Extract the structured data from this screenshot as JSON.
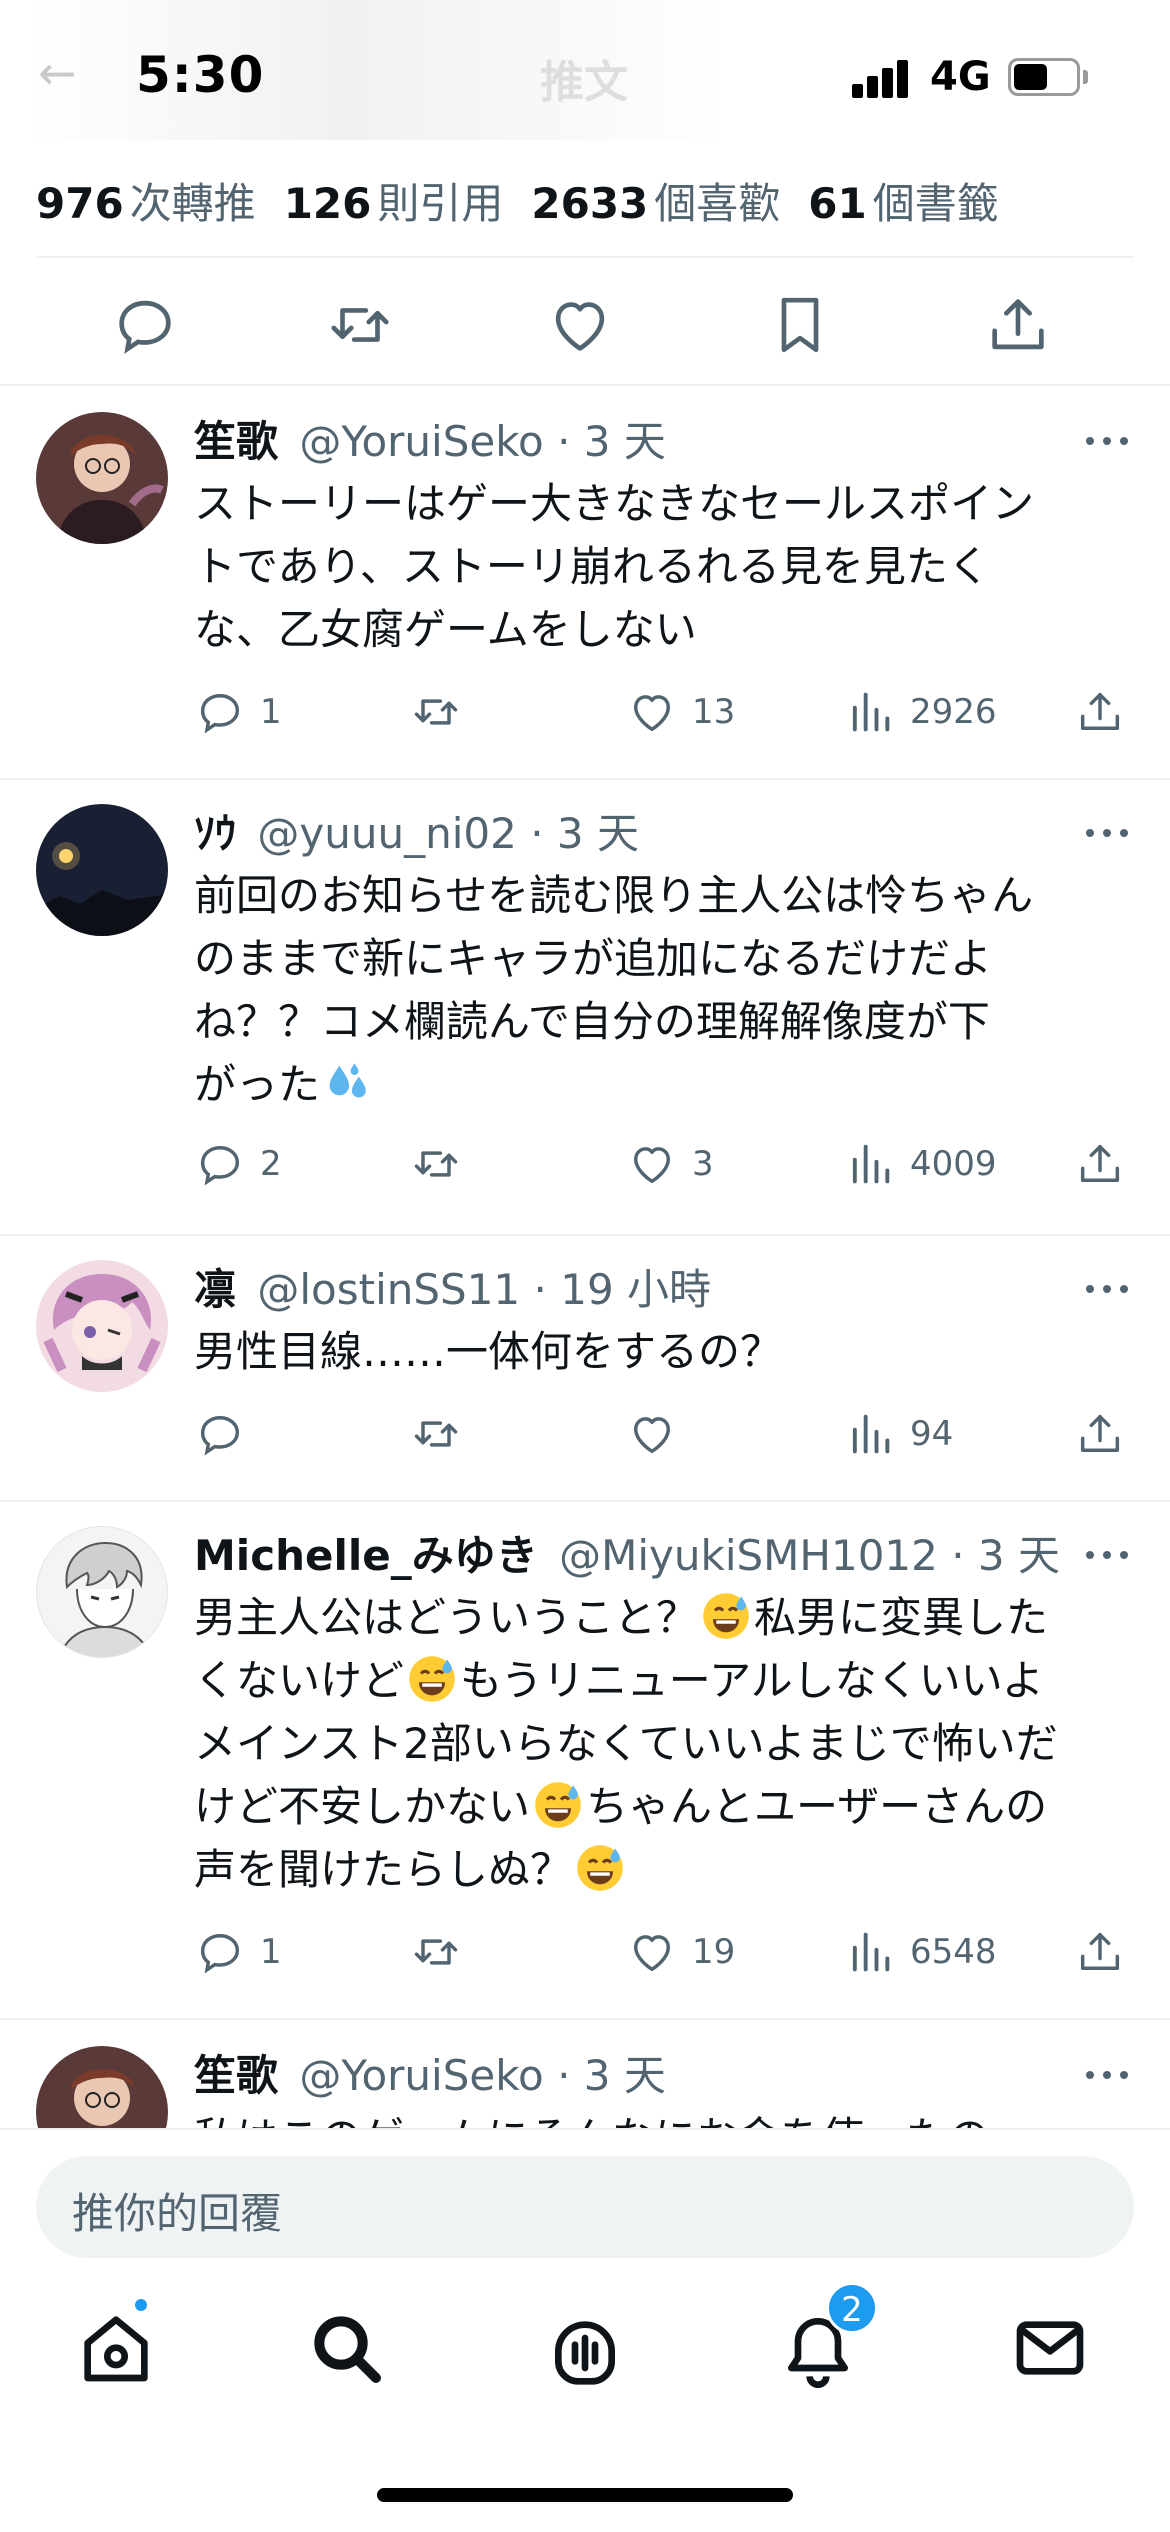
{
  "status_bar": {
    "time": "5:30",
    "network": "4G",
    "battery_level": 0.55
  },
  "header": {
    "title": "推文",
    "back_icon": "arrow-left-icon"
  },
  "stats": [
    {
      "value": "976",
      "label": "次轉推"
    },
    {
      "value": "126",
      "label": "則引用"
    },
    {
      "value": "2633",
      "label": "個喜歡"
    },
    {
      "value": "61",
      "label": "個書籤"
    }
  ],
  "tweet_actions": [
    "reply-icon",
    "retweet-icon",
    "like-icon",
    "bookmark-icon",
    "share-icon"
  ],
  "replies": [
    {
      "name": "笙歌",
      "handle": "@YoruiSeko",
      "time": "· 3 天",
      "lines": [
        "ストーリーはゲー大きなきなセールスポイン",
        "トであり、ストーリ崩れるれる見を見たく",
        "な、乙女腐ゲームをしない"
      ],
      "reply_count": "1",
      "like_count": "13",
      "view_count": "2926"
    },
    {
      "name": "ｿｳ",
      "handle": "@yuuu_ni02",
      "time": "· 3 天",
      "lines": [
        "前回のお知らせを読む限り主人公は怜ちゃん",
        "のままで新にキャラが追加になるだけだよ",
        "ね？？コメ欄読んで自分の理解解像度が下",
        "がった"
      ],
      "reply_count": "2",
      "like_count": "3",
      "view_count": "4009"
    },
    {
      "name": "凛",
      "handle": "@lostinSS11",
      "time": "· 19 小時",
      "lines": [
        "男性目線……一体何をするの？"
      ],
      "reply_count": "",
      "like_count": "",
      "view_count": "94"
    },
    {
      "name": "Michelle_みゆき",
      "handle": "@MiyukiSMH1012",
      "time": "· 3 天",
      "segments": [
        "男主人公はどういうこと？",
        "私男に変異した",
        "くないけど",
        "もうリニューアルしなくいいよ",
        "メインスト2部いらなくていいよまじで怖いだ",
        "けど不安しかない",
        "ちゃんとユーザーさんの",
        "声を聞けたらしぬ？"
      ],
      "reply_count": "1",
      "like_count": "19",
      "view_count": "6548"
    },
    {
      "name": "笙歌",
      "handle": "@YoruiSeko",
      "time": "· 3 天",
      "lines": [
        "私はこのゲームにそんなにお金を使ったの"
      ]
    }
  ],
  "composer": {
    "placeholder": "推你的回覆"
  },
  "tabbar": {
    "items": [
      "home-icon",
      "search-icon",
      "spaces-icon",
      "notifications-icon",
      "messages-icon"
    ],
    "notifications_badge": "2"
  },
  "colors": {
    "accent": "#1d9bf0",
    "text_primary": "#0f1419",
    "text_secondary": "#536471",
    "divider": "#eff3f4"
  }
}
